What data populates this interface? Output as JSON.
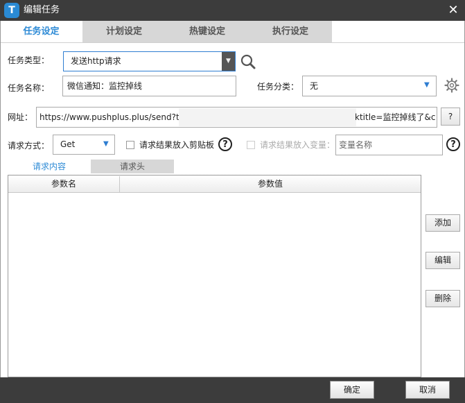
{
  "window": {
    "title": "编辑任务",
    "app_icon_letter": "T",
    "close_glyph": "✕"
  },
  "tabs": [
    {
      "label": "任务设定",
      "active": true
    },
    {
      "label": "计划设定",
      "active": false
    },
    {
      "label": "热键设定",
      "active": false
    },
    {
      "label": "执行设定",
      "active": false
    }
  ],
  "form": {
    "task_type_label": "任务类型：",
    "task_type_value": "发送http请求",
    "task_name_label": "任务名称：",
    "task_name_value": "微信通知：监控掉线",
    "task_category_label": "任务分类：",
    "task_category_value": "无",
    "url_label": "网址：",
    "url_value_start": "https://www.pushplus.plus/send?tok",
    "url_value_end": "ktitle=监控掉线了&cc",
    "url_help": "?",
    "method_label": "请求方式：",
    "method_value": "Get",
    "clipboard_label": "请求结果放入剪贴板",
    "variable_label": "请求结果放入变量：",
    "variable_placeholder": "变量名称"
  },
  "subtabs": [
    {
      "label": "请求内容",
      "active": true
    },
    {
      "label": "请求头",
      "active": false
    }
  ],
  "grid": {
    "columns": [
      "参数名",
      "参数值"
    ],
    "rows": []
  },
  "side_buttons": {
    "add": "添加",
    "edit": "编辑",
    "delete": "删除"
  },
  "footer": {
    "ok": "确定",
    "cancel": "取消"
  },
  "colors": {
    "accent": "#2e8bd6",
    "titlebar": "#3c3c3c",
    "inactive_tab": "#d7d7d7"
  }
}
